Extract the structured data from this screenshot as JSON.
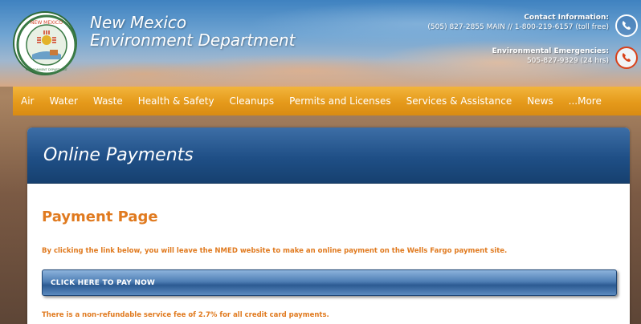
{
  "header": {
    "title_line1": "New Mexico",
    "title_line2": "Environment Department",
    "logo_top_text": "NEW MEXICO",
    "logo_bottom_text": "ENVIRONMENT DEPARTMENT",
    "contact_label": "Contact Information:",
    "contact_phones": "(505) 827-2855 MAIN // 1-800-219-6157 (toll free)",
    "emergency_label": "Environmental Emergencies:",
    "emergency_phone": "505-827-9329 (24 hrs)",
    "phone_icon": "phone-icon",
    "emergency_icon": "phone-emergency-icon"
  },
  "nav": {
    "items": [
      "Air",
      "Water",
      "Waste",
      "Health & Safety",
      "Cleanups",
      "Permits and Licenses",
      "Services & Assistance",
      "News",
      "...More"
    ]
  },
  "panel": {
    "title": "Online Payments",
    "page_title": "Payment Page",
    "info_text": "By clicking the link below, you will leave the NMED website to make an online payment on the Wells Fargo payment site.",
    "pay_button_label": "CLICK HERE TO PAY NOW",
    "fee_text": "There is a non-refundable service fee of 2.7% for all credit card payments."
  },
  "colors": {
    "nav_bg": "#e59a1b",
    "panel_header": "#1f4f86",
    "accent_orange": "#e07a1f",
    "button_blue": "#2c5a92"
  }
}
